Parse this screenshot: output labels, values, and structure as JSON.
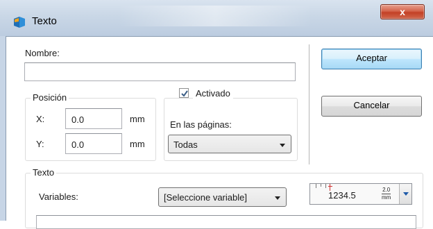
{
  "window": {
    "title": "Texto",
    "close_label": "x"
  },
  "form": {
    "nombre_label": "Nombre:",
    "nombre_value": "",
    "posicion": {
      "title": "Posición",
      "x_label": "X:",
      "x_value": "0.0",
      "x_unit": "mm",
      "y_label": "Y:",
      "y_value": "0.0",
      "y_unit": "mm"
    },
    "activado": {
      "label": "Activado",
      "checked": true
    },
    "paginas": {
      "label": "En las páginas:",
      "selected": "Todas"
    },
    "texto": {
      "title": "Texto",
      "variables_label": "Variables:",
      "variables_selected": "[Seleccione variable]",
      "size_value": "1234.5",
      "size_unit_value": "2.0",
      "size_unit": "mm"
    }
  },
  "buttons": {
    "accept": "Aceptar",
    "cancel": "Cancelar"
  }
}
